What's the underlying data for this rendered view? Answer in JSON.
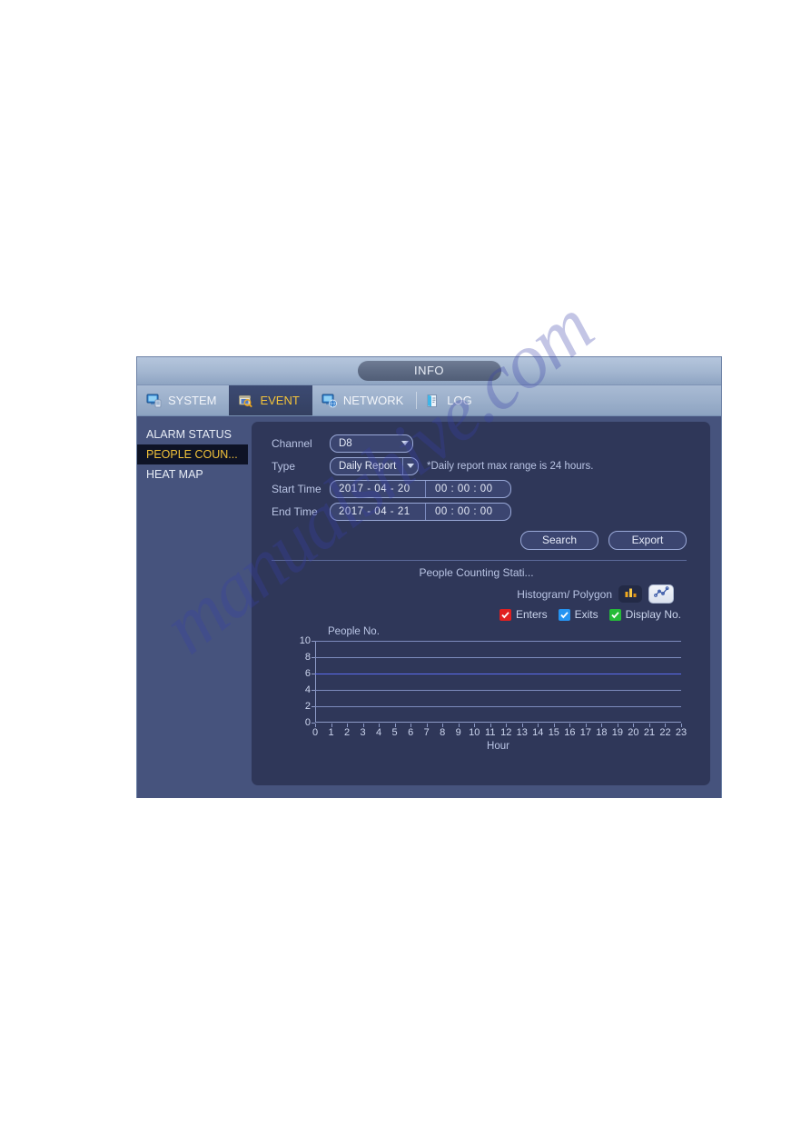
{
  "window": {
    "title": "INFO"
  },
  "tabs": [
    {
      "label": "SYSTEM",
      "icon": "monitor-icon",
      "active": false
    },
    {
      "label": "EVENT",
      "icon": "event-search-icon",
      "active": true
    },
    {
      "label": "NETWORK",
      "icon": "network-globe-icon",
      "active": false
    },
    {
      "label": "LOG",
      "icon": "log-book-icon",
      "active": false
    }
  ],
  "sidebar": {
    "items": [
      {
        "label": "ALARM STATUS",
        "active": false
      },
      {
        "label": "PEOPLE COUN...",
        "active": true
      },
      {
        "label": "HEAT MAP",
        "active": false
      }
    ]
  },
  "form": {
    "channel_label": "Channel",
    "channel_value": "D8",
    "type_label": "Type",
    "type_value": "Daily Report",
    "type_hint": "*Daily report max range is 24 hours.",
    "start_time_label": "Start Time",
    "start_date": "2017  - 04  - 20",
    "start_clock": "00 : 00 : 00",
    "end_time_label": "End Time",
    "end_date": "2017  - 04  - 21",
    "end_clock": "00 : 00 : 00"
  },
  "actions": {
    "search_label": "Search",
    "export_label": "Export"
  },
  "report": {
    "title": "People Counting Stati...",
    "mode_label": "Histogram/ Polygon",
    "histogram_selected": false,
    "polygon_selected": true,
    "legend": [
      {
        "label": "Enters",
        "checked": true,
        "color": "#e02020"
      },
      {
        "label": "Exits",
        "checked": true,
        "color": "#2594f2"
      },
      {
        "label": "Display No.",
        "checked": true,
        "color": "#25bb38"
      }
    ]
  },
  "chart_data": {
    "type": "line",
    "title": "People Counting Stati...",
    "xlabel": "Hour",
    "ylabel": "People No.",
    "x": [
      0,
      1,
      2,
      3,
      4,
      5,
      6,
      7,
      8,
      9,
      10,
      11,
      12,
      13,
      14,
      15,
      16,
      17,
      18,
      19,
      20,
      21,
      22,
      23
    ],
    "xticklabels": [
      "0",
      "1",
      "2",
      "3",
      "4",
      "5",
      "6",
      "7",
      "8",
      "9",
      "10",
      "11",
      "12",
      "13",
      "14",
      "15",
      "16",
      "17",
      "18",
      "19",
      "20",
      "21",
      "22",
      "23"
    ],
    "yticks": [
      0,
      2,
      4,
      6,
      8,
      10
    ],
    "ylim": [
      0,
      10
    ],
    "xlim": [
      0,
      23
    ],
    "grid": true,
    "legend_position": "above-right",
    "series": [
      {
        "name": "Enters",
        "color": "#e02020",
        "values": []
      },
      {
        "name": "Exits",
        "color": "#2594f2",
        "values": []
      },
      {
        "name": "Display No.",
        "color": "#25bb38",
        "values": []
      }
    ]
  },
  "watermark": {
    "text": "manualshive.com"
  },
  "colors": {
    "accent": "#f3c33a",
    "panel": "#2f3759",
    "sidebar": "#46537d"
  }
}
